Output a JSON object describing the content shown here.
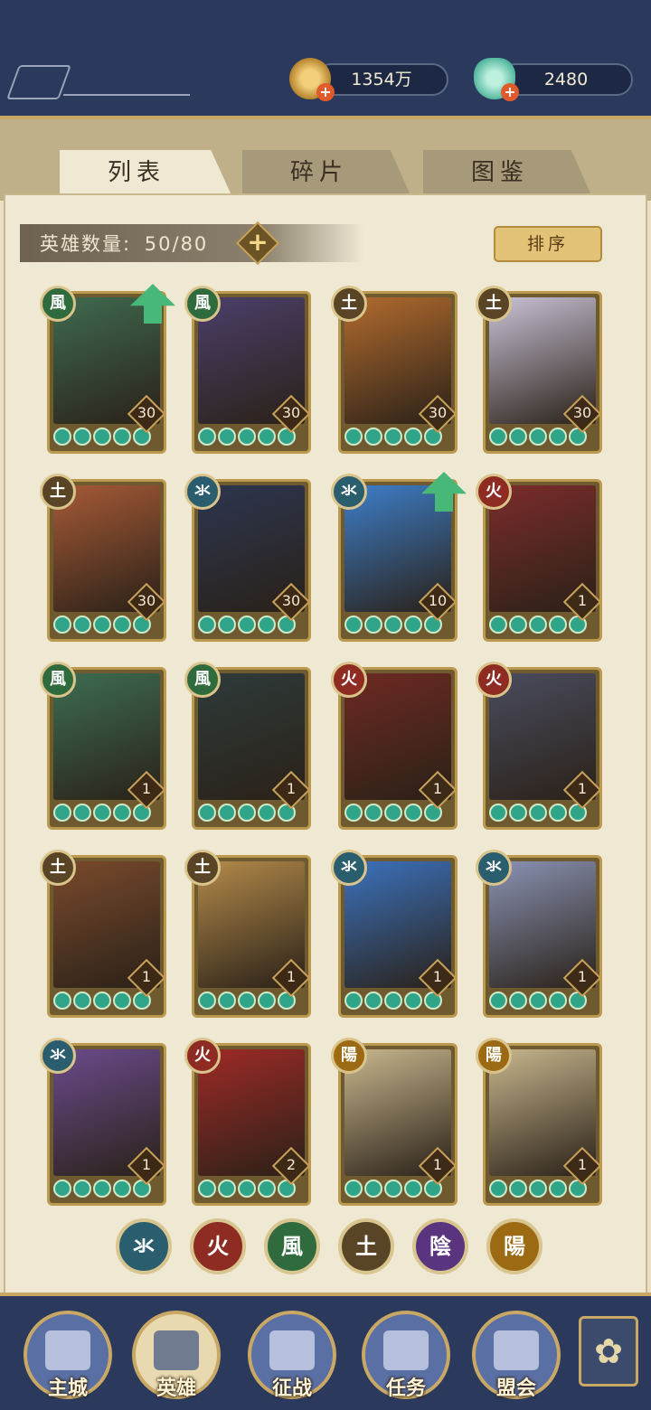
{
  "currency": {
    "coins_value": "1354万",
    "coins_icon": "coin-icon",
    "gems_value": "2480",
    "gems_icon": "jade-icon"
  },
  "tabs": [
    {
      "label": "列表",
      "active": true
    },
    {
      "label": "碎片",
      "active": false
    },
    {
      "label": "图鉴",
      "active": false
    }
  ],
  "hero_count": {
    "label": "英雄数量:",
    "value": "50/80"
  },
  "sort_label": "排序",
  "elements": {
    "water": {
      "glyph": "氺",
      "color": "#2a5e6e"
    },
    "fire": {
      "glyph": "火",
      "color": "#8e2b22"
    },
    "wind": {
      "glyph": "風",
      "color": "#2f6b3d"
    },
    "earth": {
      "glyph": "土",
      "color": "#5a4426"
    },
    "yin": {
      "glyph": "陰",
      "color": "#5b3480"
    },
    "yang": {
      "glyph": "陽",
      "color": "#9c6a12"
    }
  },
  "heroes": [
    {
      "element": "wind",
      "level": "30",
      "upgrade": true,
      "stars": 5,
      "art": "#3f6b4f"
    },
    {
      "element": "wind",
      "level": "30",
      "upgrade": false,
      "stars": 5,
      "art": "#4b3f6a"
    },
    {
      "element": "earth",
      "level": "30",
      "upgrade": false,
      "stars": 5,
      "art": "#b26b2e"
    },
    {
      "element": "earth",
      "level": "30",
      "upgrade": false,
      "stars": 5,
      "art": "#c9c2d6"
    },
    {
      "element": "earth",
      "level": "30",
      "upgrade": false,
      "stars": 5,
      "art": "#a65a36"
    },
    {
      "element": "water",
      "level": "30",
      "upgrade": false,
      "stars": 5,
      "art": "#2c3650"
    },
    {
      "element": "water",
      "level": "10",
      "upgrade": true,
      "stars": 5,
      "art": "#3d7ec9"
    },
    {
      "element": "fire",
      "level": "1",
      "upgrade": false,
      "stars": 5,
      "art": "#7c2c2b"
    },
    {
      "element": "wind",
      "level": "1",
      "upgrade": false,
      "stars": 5,
      "art": "#3d6d52"
    },
    {
      "element": "wind",
      "level": "1",
      "upgrade": false,
      "stars": 5,
      "art": "#2e3b3a"
    },
    {
      "element": "fire",
      "level": "1",
      "upgrade": false,
      "stars": 5,
      "art": "#6e2a22"
    },
    {
      "element": "fire",
      "level": "1",
      "upgrade": false,
      "stars": 5,
      "art": "#4a4c5e"
    },
    {
      "element": "earth",
      "level": "1",
      "upgrade": false,
      "stars": 5,
      "art": "#7a4a2c"
    },
    {
      "element": "earth",
      "level": "1",
      "upgrade": false,
      "stars": 5,
      "art": "#b38a4a"
    },
    {
      "element": "water",
      "level": "1",
      "upgrade": false,
      "stars": 5,
      "art": "#3b72bd"
    },
    {
      "element": "water",
      "level": "1",
      "upgrade": false,
      "stars": 5,
      "art": "#8a93b4"
    },
    {
      "element": "water",
      "level": "1",
      "upgrade": false,
      "stars": 5,
      "art": "#6a4b8c"
    },
    {
      "element": "fire",
      "level": "2",
      "upgrade": false,
      "stars": 5,
      "art": "#9e2a26"
    },
    {
      "element": "yang",
      "level": "1",
      "upgrade": false,
      "stars": 5,
      "art": "#c8b78e"
    },
    {
      "element": "yang",
      "level": "1",
      "upgrade": false,
      "stars": 5,
      "art": "#c8b78e"
    }
  ],
  "filters": [
    "water",
    "fire",
    "wind",
    "earth",
    "yin",
    "yang"
  ],
  "nav": [
    {
      "label": "主城",
      "icon": "city-gate-icon",
      "active": false
    },
    {
      "label": "英雄",
      "icon": "hero-portrait-icon",
      "active": true
    },
    {
      "label": "征战",
      "icon": "battle-drum-icon",
      "active": false
    },
    {
      "label": "任务",
      "icon": "quest-scroll-icon",
      "active": false
    },
    {
      "label": "盟会",
      "icon": "guild-pavilion-icon",
      "active": false
    }
  ],
  "menu_icon": "menu-flower-icon"
}
